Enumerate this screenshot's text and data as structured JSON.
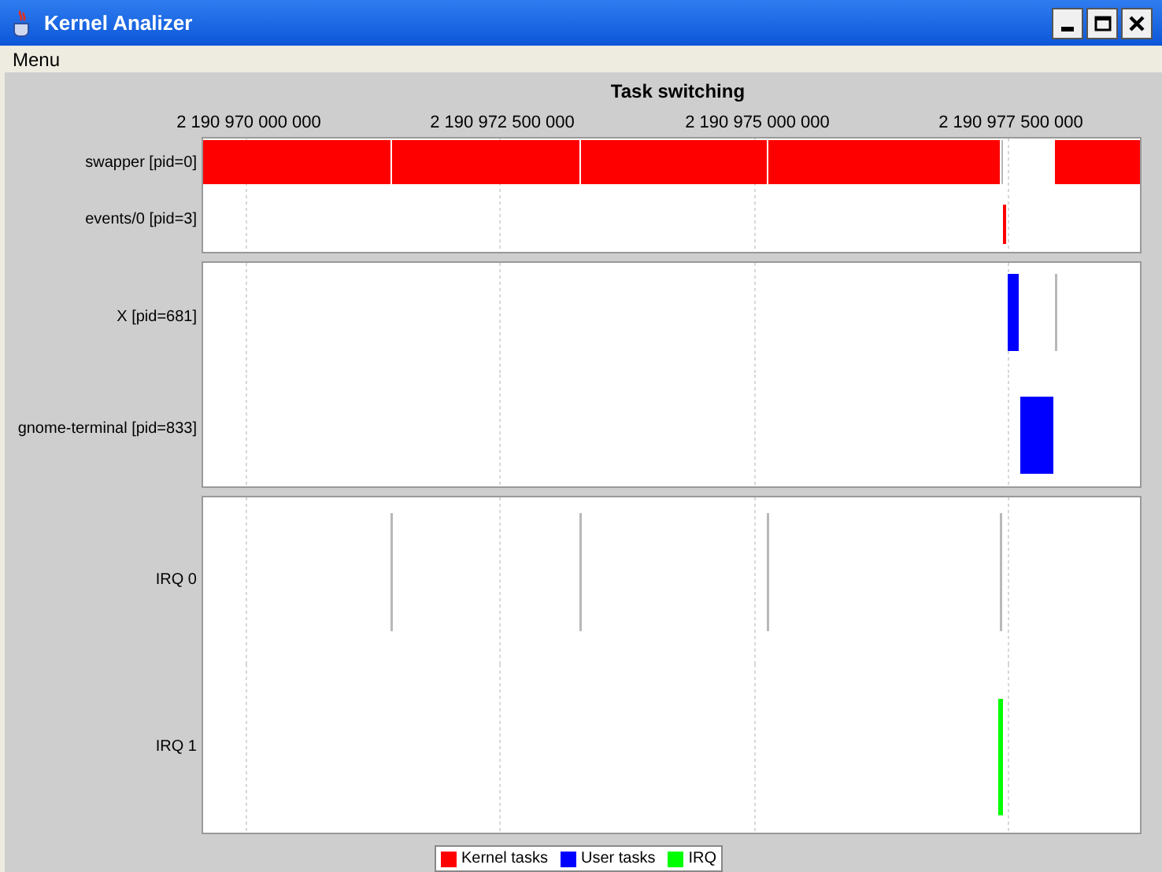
{
  "window": {
    "title": "Kernel Analizer"
  },
  "menu_bar": [
    "Menu"
  ],
  "chart": {
    "title": "Task switching",
    "x_ticks": [
      "2 190 970 000 000",
      "2 190 972 500 000",
      "2 190 975 000 000",
      "2 190 977 500 000"
    ],
    "panels": [
      {
        "rows": [
          {
            "label": "swapper [pid=0]",
            "kind": "kernel"
          },
          {
            "label": "events/0 [pid=3]",
            "kind": "kernel"
          }
        ]
      },
      {
        "rows": [
          {
            "label": "X [pid=681]",
            "kind": "user"
          },
          {
            "label": "gnome-terminal [pid=833]",
            "kind": "user"
          }
        ]
      },
      {
        "rows": [
          {
            "label": "IRQ 0",
            "kind": "irq"
          },
          {
            "label": "IRQ 1",
            "kind": "irq"
          }
        ]
      }
    ],
    "legend": [
      {
        "label": "Kernel tasks",
        "kind": "kernel",
        "color": "#ff0000"
      },
      {
        "label": "User tasks",
        "kind": "user",
        "color": "#0000ff"
      },
      {
        "label": "IRQ",
        "kind": "irq",
        "color": "#00ff00"
      }
    ]
  }
}
